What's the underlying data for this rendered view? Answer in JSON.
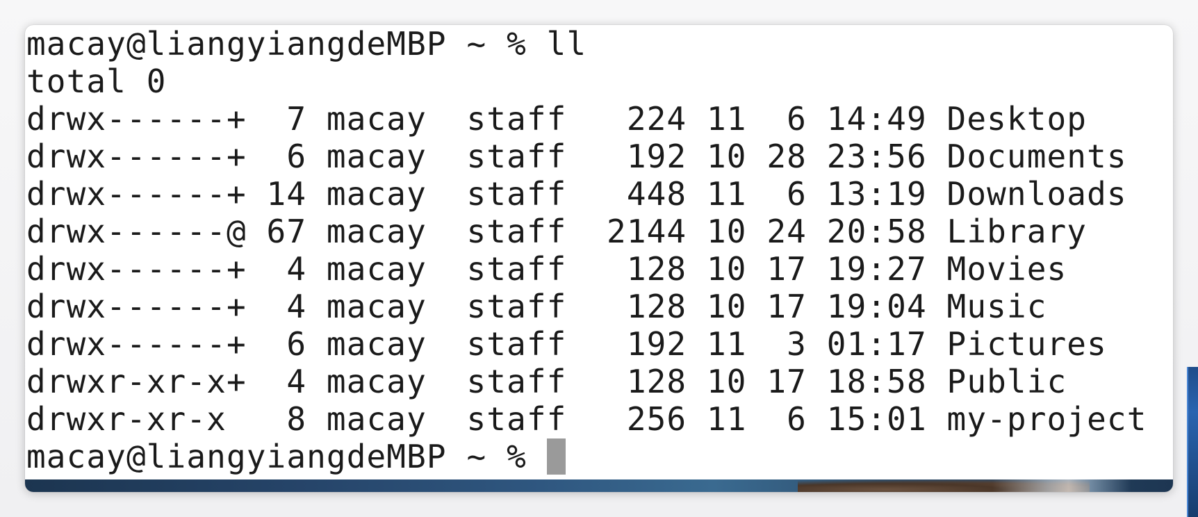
{
  "terminal": {
    "lines": [
      "macay@liangyiangdeMBP ~ % ll",
      "total 0",
      "drwx------+  7 macay  staff   224 11  6 14:49 Desktop",
      "drwx------+  6 macay  staff   192 10 28 23:56 Documents",
      "drwx------+ 14 macay  staff   448 11  6 13:19 Downloads",
      "drwx------@ 67 macay  staff  2144 10 24 20:58 Library",
      "drwx------+  4 macay  staff   128 10 17 19:27 Movies",
      "drwx------+  4 macay  staff   128 10 17 19:04 Music",
      "drwx------+  6 macay  staff   192 11  3 01:17 Pictures",
      "drwxr-xr-x+  4 macay  staff   128 10 17 18:58 Public",
      "drwxr-xr-x   8 macay  staff   256 11  6 15:01 my-project"
    ],
    "prompt": "macay@liangyiangdeMBP ~ % ",
    "cursor_color": "#9a9a9a",
    "text_color": "#1a1a1a",
    "background_color": "#ffffff"
  }
}
